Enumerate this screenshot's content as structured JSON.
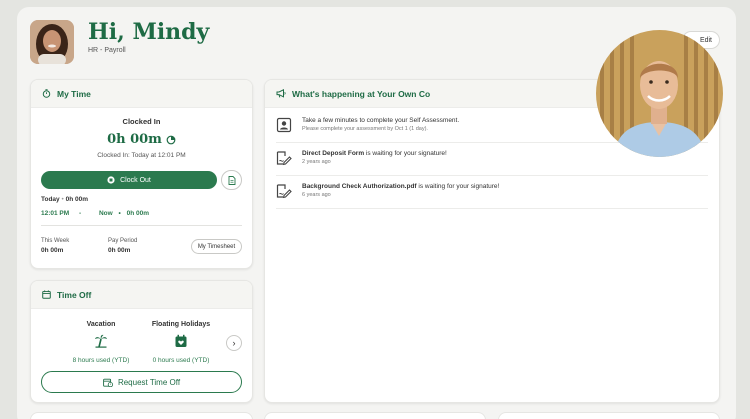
{
  "header": {
    "greeting": "Hi, Mindy",
    "role": "HR - Payroll",
    "edit_label": "Edit"
  },
  "my_time": {
    "title": "My Time",
    "status_label": "Clocked In",
    "elapsed": "0h 00m",
    "clocked_in_at": "Clocked In: Today at 12:01 PM",
    "clock_out_label": "Clock Out",
    "today_label": "Today",
    "today_total": "0h 00m",
    "entry_start": "12:01 PM",
    "entry_end": "Now",
    "entry_duration": "0h 00m",
    "this_week_label": "This Week",
    "this_week_value": "0h 00m",
    "pay_period_label": "Pay Period",
    "pay_period_value": "0h 00m",
    "timesheet_label": "My Timesheet"
  },
  "time_off": {
    "title": "Time Off",
    "balances": [
      {
        "name": "Vacation",
        "used": "8 hours used (YTD)",
        "icon": "palm-tree-icon"
      },
      {
        "name": "Floating Holidays",
        "used": "0 hours used (YTD)",
        "icon": "calendar-heart-icon"
      }
    ],
    "request_label": "Request Time Off"
  },
  "happening": {
    "title": "What's happening at Your Own Co",
    "items": [
      {
        "icon": "person-card-icon",
        "title": "Take a few minutes to complete your Self Assessment.",
        "sub": "Please complete your assessment by Oct 1 (1 day)."
      },
      {
        "icon": "signature-icon",
        "bold": "Direct Deposit Form",
        "rest": " is waiting for your signature!",
        "sub": "2 years ago"
      },
      {
        "icon": "signature-icon",
        "bold": "Background Check Authorization.pdf",
        "rest": " is waiting for your signature!",
        "sub": "6 years ago"
      }
    ]
  },
  "colors": {
    "brand": "#1e6b45",
    "button": "#2b7a4e"
  }
}
